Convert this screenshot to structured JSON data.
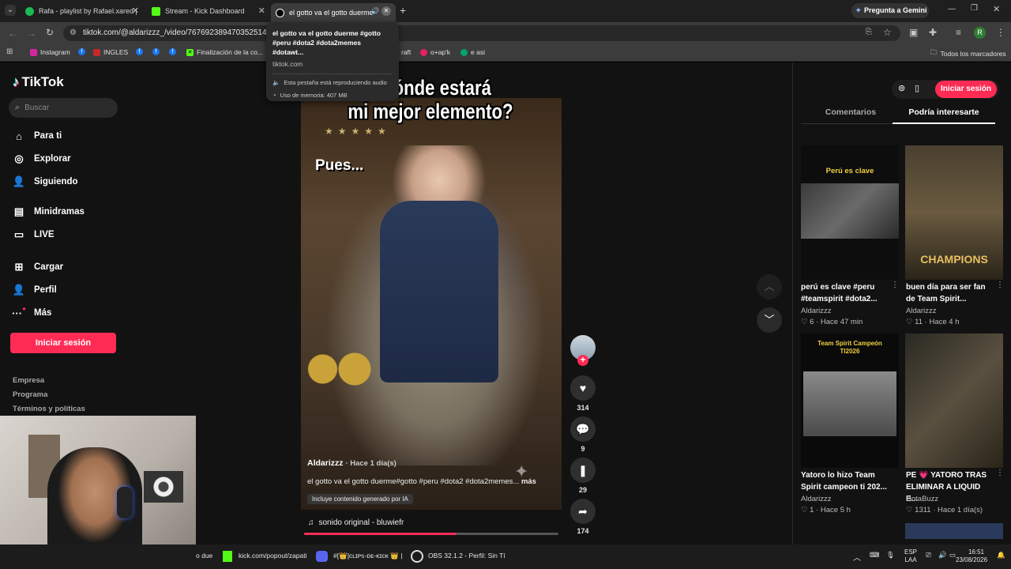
{
  "browser": {
    "tabs": [
      {
        "title": "Rafa - playlist by Rafael.xared |",
        "color": "#1db954"
      },
      {
        "title": "Stream - Kick Dashboard",
        "color": "#53fc18"
      },
      {
        "title": "el gotto va el gotto duerme",
        "color": "#ffffff"
      }
    ],
    "gemini_button": "Pregunta a Gemini",
    "url": "tiktok.com/@aldarizzz_/video/7676923894703525140?_r",
    "profile_initial": "R",
    "bookmarks": [
      "Instagram",
      "INGLES",
      "Finalización de la co...",
      "raft",
      "o+ap'k",
      "e asi"
    ],
    "all_bookmarks": "Todos los marcadores"
  },
  "tooltip": {
    "title": "el gotto va el gotto duerme #gotto #peru #dota2 #dota2memes #dotawt...",
    "domain": "tiktok.com",
    "audio": "Esta pestaña está reproduciendo audio",
    "memory": "Uso de memoria: 407 MB"
  },
  "tiktok": {
    "logo": "TikTok",
    "search_placeholder": "Buscar",
    "nav": [
      "Para ti",
      "Explorar",
      "Siguiendo",
      "Minidramas",
      "LIVE",
      "Cargar",
      "Perfil",
      "Más"
    ],
    "login": "Iniciar sesión",
    "footer": [
      "Empresa",
      "Programa",
      "Términos y políticas"
    ],
    "video": {
      "caption_top_1": "¿Dónde estará",
      "caption_top_2": "mi mejor elemento?",
      "caption_mid": "Pues...",
      "author": "Aldarizzz",
      "posted": "· Hace 1 día(s)",
      "description": "el gotto va el gotto duerme#gotto #peru #dota2 #dota2memes...",
      "more": "más",
      "ai_label": "Incluye contenido generado por IA",
      "sound": "sonido original - bluwiefr",
      "progress": 0.6
    },
    "actions": {
      "likes": "314",
      "comments": "9",
      "saves": "29",
      "shares": "174"
    },
    "right": {
      "login": "Iniciar sesión",
      "tabs": [
        "Comentarios",
        "Podría interesarte"
      ],
      "cards": [
        {
          "thumb_text": "Perú es clave",
          "title": "perú es clave #peru #teamspirit #dota2...",
          "author": "Aldarizzz",
          "likes": "6",
          "time": "Hace 47 min"
        },
        {
          "thumb_text": "CHAMPIONS",
          "title": "buen día para ser fan de Team Spirit...",
          "author": "Aldarizzz",
          "likes": "11",
          "time": "Hace 4 h"
        },
        {
          "thumb_text": "Team Spirit Campeón TI2026",
          "title": "Yatoro lo hizo Team Spirit campeon ti 202...",
          "author": "Aldarizzz",
          "likes": "1",
          "time": "Hace 5 h"
        },
        {
          "thumb_text": "",
          "title": "PE 💗 YATORO TRAS ELIMINAR A LIQUID E...",
          "author": "DotaBuzz",
          "likes": "1311",
          "time": "Hace 1 día(s)"
        }
      ]
    }
  },
  "taskbar": {
    "items": [
      "o due",
      "kick.com/popout/zapati",
      "#[👑]ᴄʟɪᴘꜱ-ᴅᴇ-ᴋɪᴄᴋ 👑 |",
      "OBS 32.1.2 - Perfil: Sin Tí"
    ],
    "lang": "ESP",
    "lang2": "LAA",
    "time": "16:51",
    "date": "23/08/2026"
  }
}
